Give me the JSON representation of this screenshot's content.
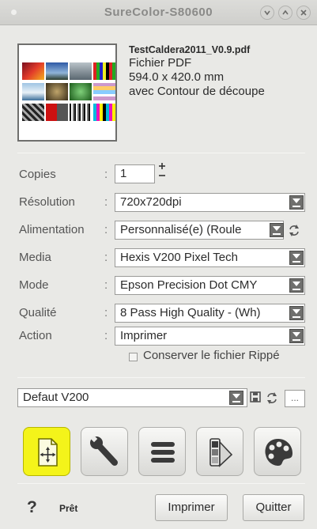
{
  "window": {
    "title": "SureColor-S80600"
  },
  "file": {
    "name": "TestCaldera2011_V0.9.pdf",
    "type": "Fichier PDF",
    "size": "594.0 x 420.0 mm",
    "cut": "avec Contour de découpe"
  },
  "settings": {
    "copies": {
      "label": "Copies",
      "value": "1"
    },
    "resolution": {
      "label": "Résolution",
      "value": "720x720dpi"
    },
    "feed": {
      "label": "Alimentation",
      "value": "Personnalisé(e) (Roule"
    },
    "media": {
      "label": "Media",
      "value": "Hexis V200 Pixel Tech"
    },
    "mode": {
      "label": "Mode",
      "value": "Epson Precision Dot CMY"
    },
    "quality": {
      "label": "Qualité",
      "value": "8 Pass High Quality - (Wh)"
    },
    "action": {
      "label": "Action",
      "value": "Imprimer"
    },
    "keep_ripped": {
      "label": "Conserver le fichier Rippé",
      "checked": false
    }
  },
  "preset": {
    "value": "Defaut V200",
    "more": "..."
  },
  "footer": {
    "help": "?",
    "status": "Prêt",
    "print_label": "Imprimer",
    "quit_label": "Quitter"
  },
  "colors": {
    "active_tool": "#f4f41a"
  },
  "icons": {
    "tools": [
      "layout-icon",
      "wrench-icon",
      "list-icon",
      "color-swatch-icon",
      "palette-icon"
    ]
  }
}
